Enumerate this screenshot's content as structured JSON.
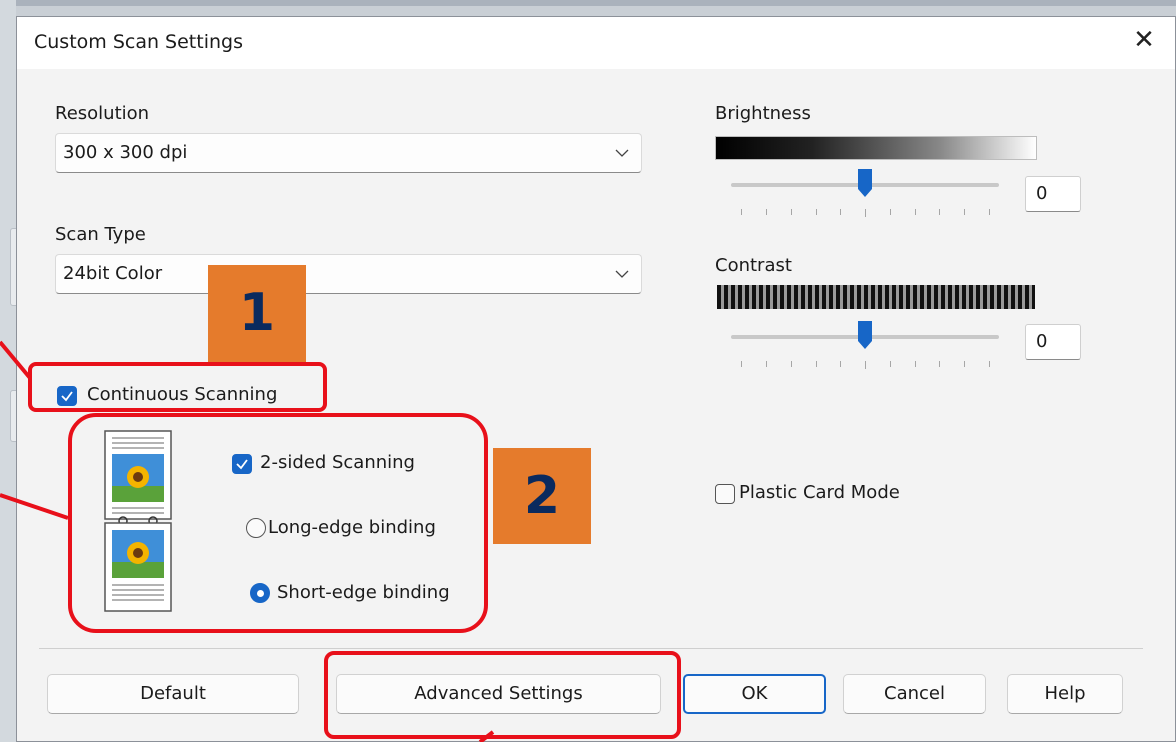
{
  "dialog": {
    "title": "Custom Scan Settings",
    "close_glyph": "✕"
  },
  "resolution": {
    "label": "Resolution",
    "value": "300 x 300 dpi"
  },
  "scan_type": {
    "label": "Scan Type",
    "value": "24bit Color"
  },
  "continuous_scanning": {
    "label": "Continuous Scanning",
    "checked": true
  },
  "two_sided": {
    "label": "2-sided Scanning",
    "checked": true,
    "long_edge": {
      "label": "Long-edge binding",
      "selected": false
    },
    "short_edge": {
      "label": "Short-edge binding",
      "selected": true
    }
  },
  "brightness": {
    "label": "Brightness",
    "value": "0",
    "slider_fraction": 0.5
  },
  "contrast": {
    "label": "Contrast",
    "value": "0",
    "slider_fraction": 0.5
  },
  "plastic_card": {
    "label": "Plastic Card Mode",
    "checked": false
  },
  "buttons": {
    "default": "Default",
    "advanced": "Advanced Settings",
    "ok": "OK",
    "cancel": "Cancel",
    "help": "Help"
  },
  "callouts": {
    "one": "1",
    "two": "2"
  },
  "colors": {
    "accent": "#1766c7",
    "highlight": "#e8101a",
    "badge": "#e57b2c",
    "badge_text": "#0a2a5e"
  }
}
